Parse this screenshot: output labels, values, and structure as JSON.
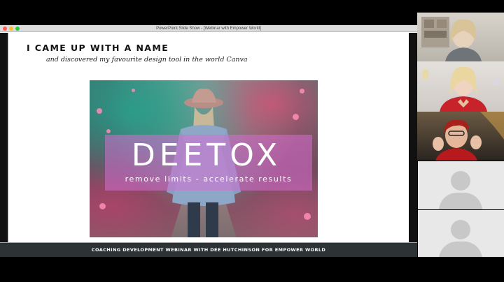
{
  "window": {
    "title": "PowerPoint Slide Show - [Webinar with Empower World]"
  },
  "slide": {
    "heading": "I CAME UP WITH A NAME",
    "subheading": "and discovered my favourite design tool in the world Canva",
    "image": {
      "logo_text": "DEETOX",
      "tagline": "remove limits - accelerate results"
    },
    "footer": "COACHING DEVELOPMENT WEBINAR WITH DEE HUTCHINSON FOR EMPOWER WORLD"
  },
  "participants": [
    {
      "kind": "video"
    },
    {
      "kind": "video"
    },
    {
      "kind": "video"
    },
    {
      "kind": "avatar-placeholder"
    },
    {
      "kind": "avatar-placeholder"
    }
  ],
  "colors": {
    "accent_gold": "#c9a24a",
    "footer_bg": "#2d3234",
    "overlay_pink": "#d66ed2"
  }
}
